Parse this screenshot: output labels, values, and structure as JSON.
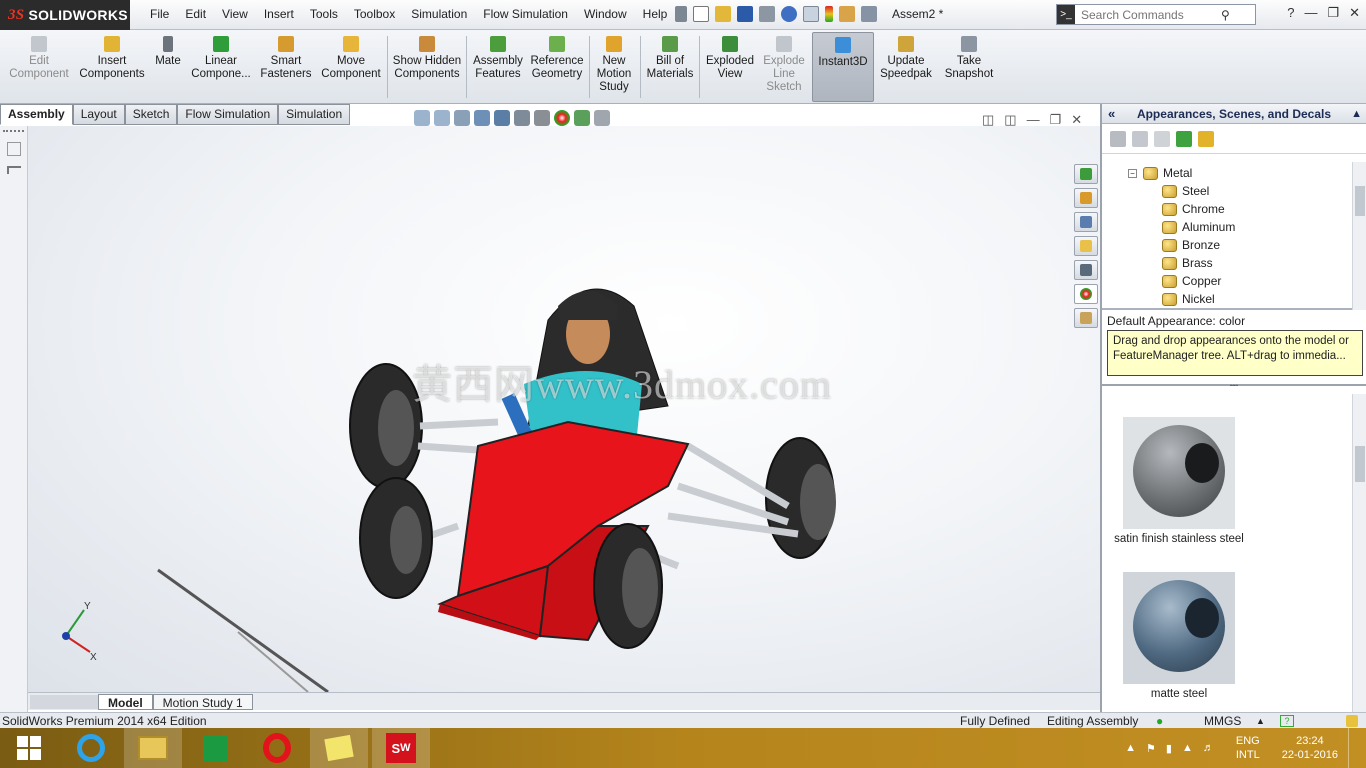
{
  "app": {
    "brand": "SOLIDWORKS",
    "ds_mark": "3S",
    "doc_title": "Assem2 *"
  },
  "menu": [
    "File",
    "Edit",
    "View",
    "Insert",
    "Tools",
    "Toolbox",
    "Simulation",
    "Flow Simulation",
    "Window",
    "Help"
  ],
  "search": {
    "placeholder": "Search Commands"
  },
  "ribbon": [
    {
      "label": "Edit Component",
      "state": "disabled"
    },
    {
      "label": "Insert Components",
      "state": "normal"
    },
    {
      "label": "Mate",
      "state": "normal"
    },
    {
      "label": "Linear Compone...",
      "state": "normal"
    },
    {
      "label": "Smart Fasteners",
      "state": "normal"
    },
    {
      "label": "Move Component",
      "state": "normal"
    },
    {
      "label": "Show Hidden Components",
      "state": "normal"
    },
    {
      "label": "Assembly Features",
      "state": "normal"
    },
    {
      "label": "Reference Geometry",
      "state": "normal"
    },
    {
      "label": "New Motion Study",
      "state": "normal"
    },
    {
      "label": "Bill of Materials",
      "state": "normal"
    },
    {
      "label": "Exploded View",
      "state": "normal"
    },
    {
      "label": "Explode Line Sketch",
      "state": "disabled"
    },
    {
      "label": "Instant3D",
      "state": "active"
    },
    {
      "label": "Update Speedpak",
      "state": "normal"
    },
    {
      "label": "Take Snapshot",
      "state": "normal"
    }
  ],
  "cm_tabs": [
    "Assembly",
    "Layout",
    "Sketch",
    "Flow Simulation",
    "Simulation"
  ],
  "cm_active": "Assembly",
  "watermark": "黄西网www.3dmox.com",
  "triad": {
    "y": "Y",
    "x": "X"
  },
  "bottom_tabs": [
    "Model",
    "Motion Study 1"
  ],
  "panel": {
    "title": "Appearances, Scenes, and Decals",
    "tree_root": "Metal",
    "tree_items": [
      "Steel",
      "Chrome",
      "Aluminum",
      "Bronze",
      "Brass",
      "Copper",
      "Nickel"
    ],
    "default_appearance": "Default Appearance: color",
    "tooltip": "Drag and drop appearances onto the model or FeatureManager tree.  ALT+drag to immedia...",
    "swatches": [
      {
        "label": "satin finish stainless steel",
        "color": "#6f7275"
      },
      {
        "label": "matte steel",
        "color": "#4f6a82"
      }
    ]
  },
  "status": {
    "edition": "SolidWorks Premium 2014 x64 Edition",
    "state": "Fully Defined",
    "mode": "Editing Assembly",
    "units": "MMGS"
  },
  "taskbar": {
    "apps": [
      "start",
      "ie",
      "explorer",
      "store",
      "opera",
      "sticky-notes",
      "solidworks"
    ],
    "lang1": "ENG",
    "lang2": "INTL",
    "time": "23:24",
    "date": "22-01-2016"
  },
  "colors": {
    "accent": "#1d2c55",
    "tooltip_bg": "#ffffc8",
    "car_body": "#e8141c",
    "taskbar": "#b5851c"
  }
}
